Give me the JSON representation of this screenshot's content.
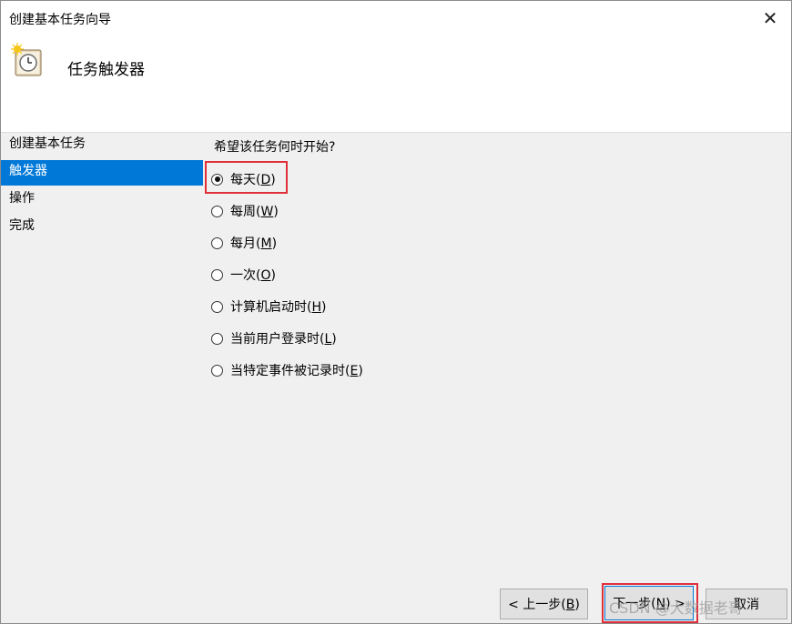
{
  "window": {
    "title": "创建基本任务向导",
    "close_label": "✕"
  },
  "header": {
    "title": "任务触发器",
    "icon": "clock-icon"
  },
  "steps": [
    {
      "label": "创建基本任务",
      "active": false
    },
    {
      "label": "触发器",
      "active": true
    },
    {
      "label": "操作",
      "active": false
    },
    {
      "label": "完成",
      "active": false
    }
  ],
  "content": {
    "question": "希望该任务何时开始?",
    "options": [
      {
        "text": "每天(",
        "key": "D",
        "checked": true
      },
      {
        "text": "每周(",
        "key": "W",
        "checked": false
      },
      {
        "text": "每月(",
        "key": "M",
        "checked": false
      },
      {
        "text": "一次(",
        "key": "O",
        "checked": false
      },
      {
        "text": "计算机启动时(",
        "key": "H",
        "checked": false
      },
      {
        "text": "当前用户登录时(",
        "key": "L",
        "checked": false
      },
      {
        "text": "当特定事件被记录时(",
        "key": "E",
        "checked": false
      }
    ]
  },
  "buttons": {
    "back": {
      "text": "< 上一步(",
      "key": "B"
    },
    "next": {
      "text": "下一步(",
      "key": "N",
      "suffix": ") >"
    },
    "cancel": {
      "text": "取消"
    }
  },
  "watermark": "CSDN @大数据老哥"
}
